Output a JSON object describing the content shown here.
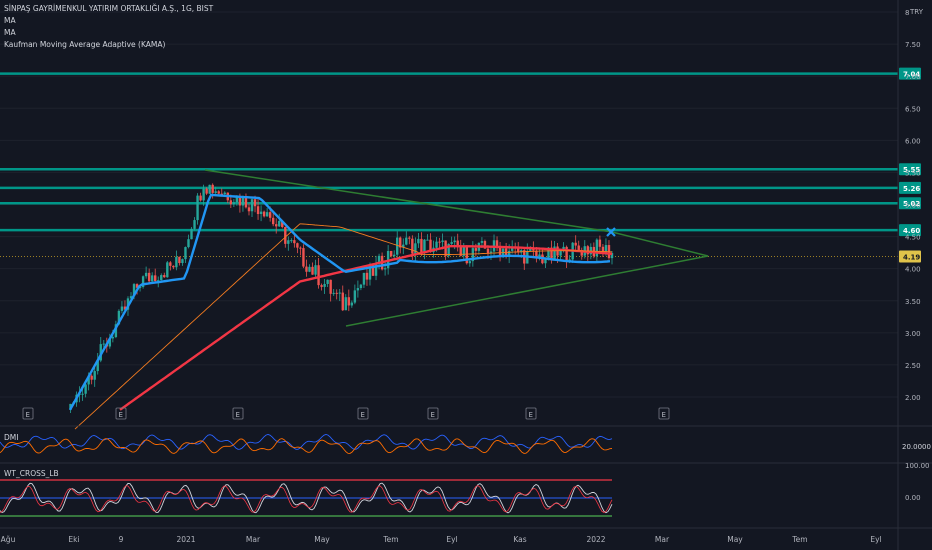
{
  "header": {
    "symbol": "SİNPAŞ GAYRİMENKUL YATIRIM ORTAKLIĞI A.Ş., 1G, BIST",
    "indicators": [
      "MA",
      "MA",
      "Kaufman Moving Average Adaptive (KAMA)"
    ],
    "currency": "TRY"
  },
  "panes": {
    "dmi_label": "DMI",
    "dmi_value": "20.0000",
    "wt_label": "WT_CROSS_LB",
    "wt_ticks": [
      "100.00",
      "0.00"
    ]
  },
  "chart_data": {
    "type": "line",
    "price_axis_ticks": [
      "8",
      "7.50",
      "7.00",
      "6.50",
      "6.00",
      "5.50",
      "5.00",
      "4.50",
      "4.00",
      "3.50",
      "3.00",
      "2.50",
      "2.00"
    ],
    "x_tick_labels": [
      "Ağu",
      "Eki",
      "9",
      "2021",
      "Mar",
      "May",
      "Tem",
      "Eyl",
      "Kas",
      "2022",
      "Mar",
      "May",
      "Tem",
      "Eyl"
    ],
    "horizontal_levels": [
      {
        "value": 7.04,
        "label": "7.04"
      },
      {
        "value": 5.55,
        "label": "5.55"
      },
      {
        "value": 5.26,
        "label": "5.26"
      },
      {
        "value": 5.02,
        "label": "5.02"
      },
      {
        "value": 4.6,
        "label": "4.60"
      }
    ],
    "last_price": {
      "value": 4.19,
      "label": "4.19"
    },
    "earnings_markers": [
      "E",
      "E",
      "E",
      "E",
      "E",
      "E",
      "E"
    ],
    "colors": {
      "kama": "#2196f3",
      "ma_long": "#f23645",
      "ma_medium": "#f57c20",
      "levels": "#009688",
      "triangle": "#2e7d32",
      "candle_up": "#26a69a",
      "candle_down": "#ef5350"
    }
  }
}
